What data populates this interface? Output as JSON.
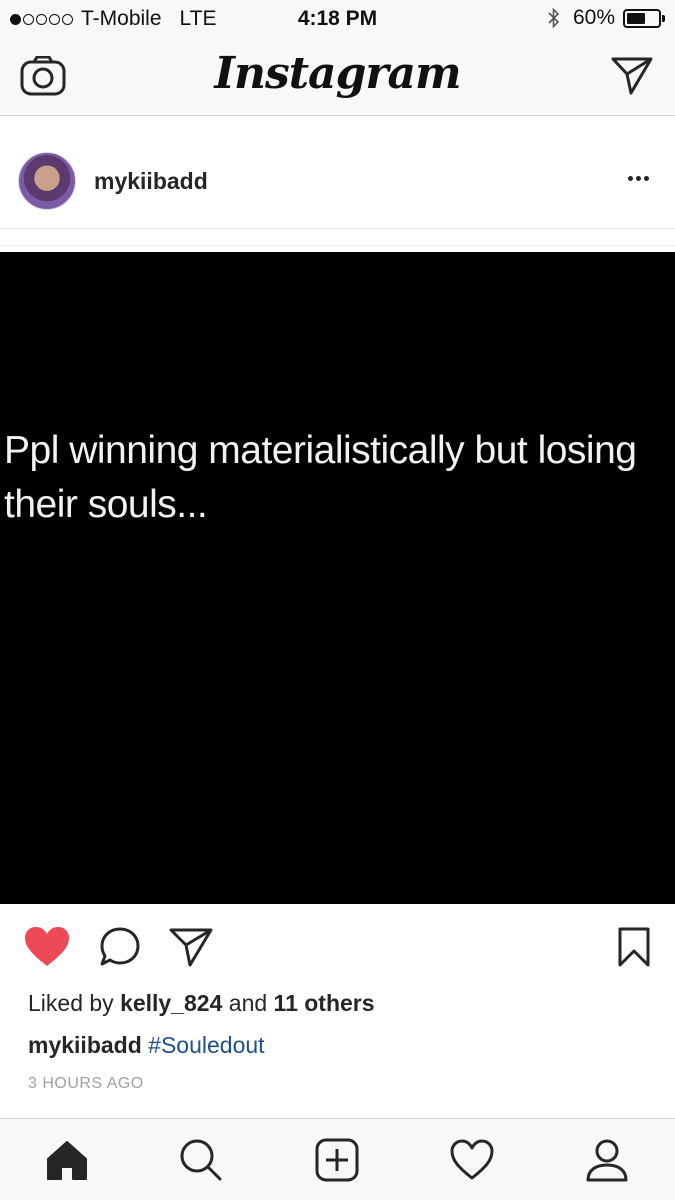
{
  "status_bar": {
    "carrier": "T-Mobile",
    "network": "LTE",
    "time": "4:18 PM",
    "battery_percent": "60%",
    "battery_level": 0.6,
    "signal_bars_filled": 1,
    "signal_bars_total": 5
  },
  "header": {
    "logo": "Instagram",
    "left_icon": "camera-icon",
    "right_icon": "paper-plane-icon"
  },
  "post": {
    "username": "mykiibadd",
    "image_text": "Ppl winning materialistically but losing their souls...",
    "likes_prefix": "Liked by",
    "liked_by_user": "kelly_824",
    "likes_joiner": "and",
    "likes_others": "11 others",
    "caption_user": "mykiibadd",
    "caption_hashtag": "#Souledout",
    "timestamp": "3 HOURS AGO",
    "liked": true
  },
  "colors": {
    "like_red": "#ed4956",
    "hashtag_blue": "#1f4f8b",
    "bar_background": "#f8f8f8"
  },
  "tab_bar": {
    "tabs": [
      "home-icon",
      "search-icon",
      "add-post-icon",
      "activity-heart-icon",
      "profile-icon"
    ],
    "active": "home-icon"
  }
}
